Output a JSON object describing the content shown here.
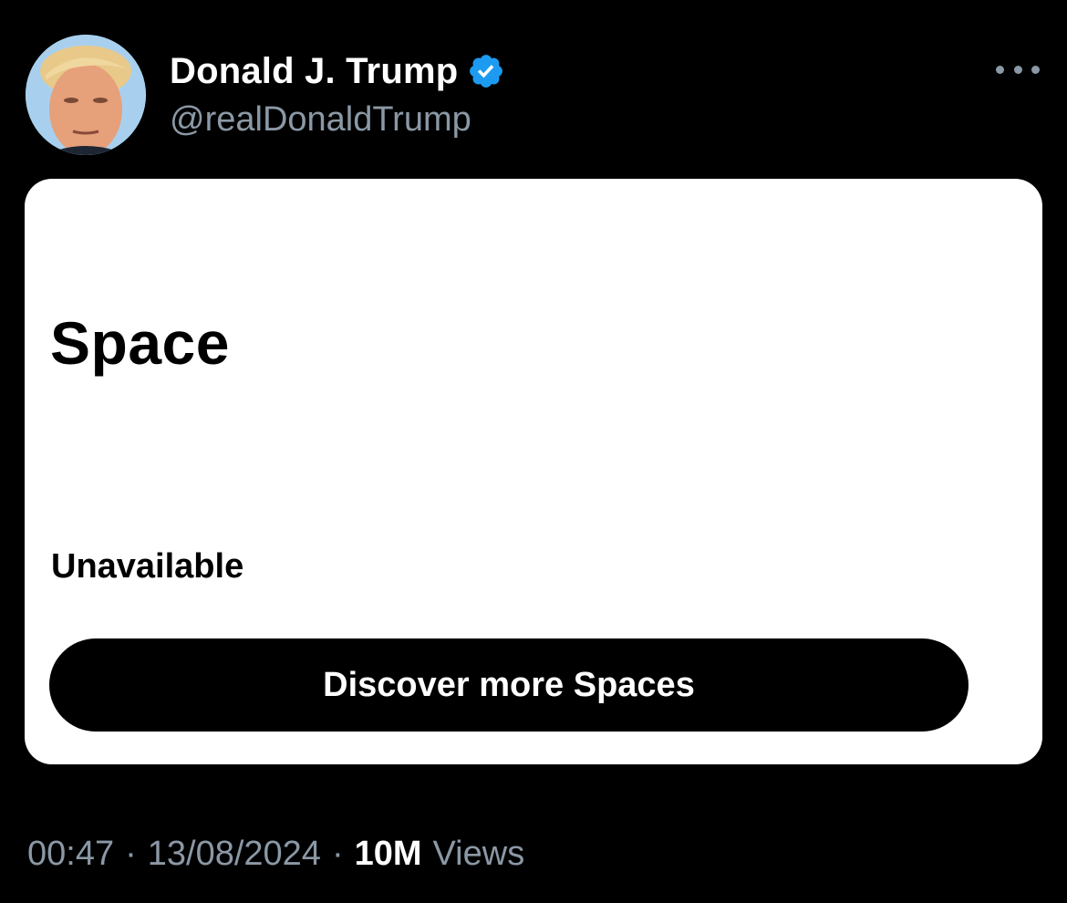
{
  "author": {
    "display_name": "Donald J. Trump",
    "handle": "@realDonaldTrump",
    "avatar_icon": "user-avatar",
    "verified_icon": "verified-badge-icon",
    "verified_color": "#1d9bf0"
  },
  "menu": {
    "icon": "more-options-icon"
  },
  "space_card": {
    "title": "Space",
    "status": "Unavailable",
    "button_label": "Discover more Spaces"
  },
  "meta": {
    "time": "00:47",
    "date": "13/08/2024",
    "separator": "·",
    "views_count": "10M",
    "views_label": "Views"
  },
  "colors": {
    "background": "#000000",
    "card": "#ffffff",
    "muted_text": "#8b98a5",
    "accent": "#1d9bf0"
  }
}
